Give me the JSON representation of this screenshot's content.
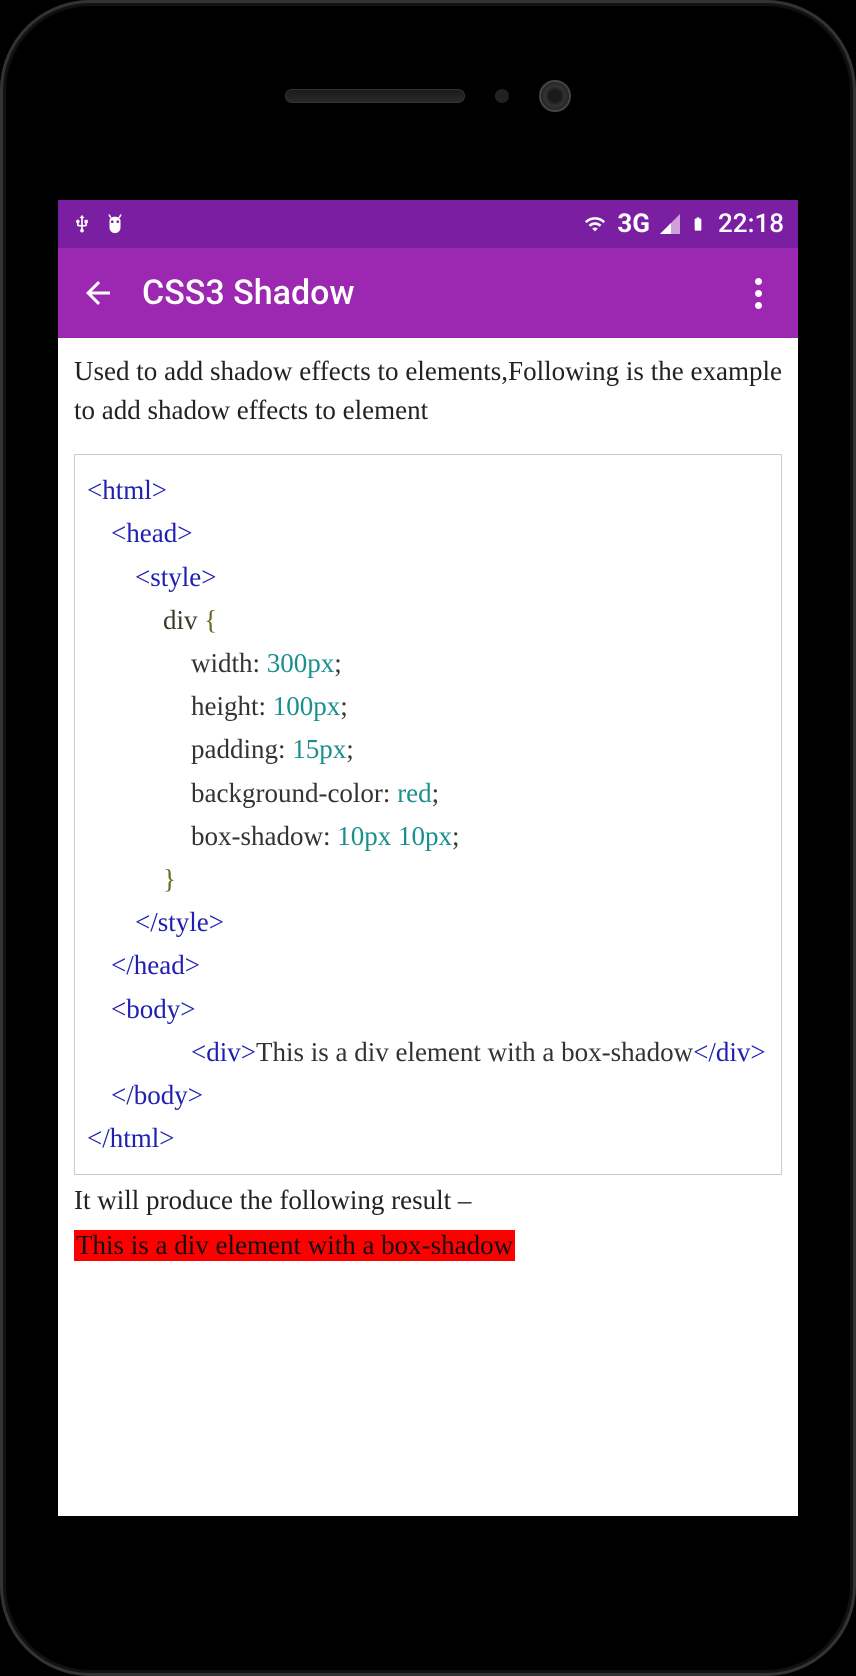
{
  "statusbar": {
    "network": "3G",
    "time": "22:18"
  },
  "appbar": {
    "title": "CSS3 Shadow"
  },
  "content": {
    "intro": "Used to add shadow effects to elements,Following is the example to add shadow effects to element",
    "code": {
      "l1": "<html>",
      "l2": "<head>",
      "l3": "<style>",
      "l4_sel": "div ",
      "l4_brace": "{",
      "l5_prop": "width:",
      "l5_val": " 300px",
      "l5_semi": ";",
      "l6_prop": "height:",
      "l6_val": " 100px",
      "l6_semi": ";",
      "l7_prop": "padding:",
      "l7_val": " 15px",
      "l7_semi": ";",
      "l8_prop": "background-color:",
      "l8_val": " red",
      "l8_semi": ";",
      "l9_prop": "box-shadow:",
      "l9_val": " 10px 10px",
      "l9_semi": ";",
      "l10_brace": "}",
      "l11": "</style>",
      "l12": "</head>",
      "l13": "<body>",
      "l14_open": "<div>",
      "l14_text": "This is a div element with a box-shadow",
      "l14_close": "</div>",
      "l15": "</body>",
      "l16": "</html>"
    },
    "result_label": "It will produce the following result –",
    "result_box": "This is a div element with a box-shadow"
  }
}
